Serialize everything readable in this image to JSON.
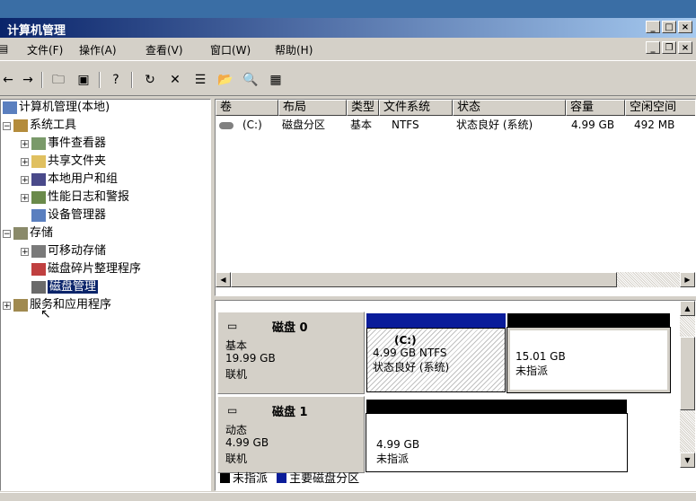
{
  "window": {
    "title": "计算机管理"
  },
  "menu": {
    "items": [
      "文件(F)",
      "操作(A)",
      "查看(V)",
      "窗口(W)",
      "帮助(H)"
    ]
  },
  "tree": {
    "root": "计算机管理(本地)",
    "system_tools": "系统工具",
    "event_viewer": "事件查看器",
    "shared_folders": "共享文件夹",
    "local_users": "本地用户和组",
    "perf_logs": "性能日志和警报",
    "device_manager": "设备管理器",
    "storage": "存储",
    "removable_storage": "可移动存储",
    "defrag": "磁盘碎片整理程序",
    "disk_mgmt": "磁盘管理",
    "services_apps": "服务和应用程序"
  },
  "volume_list": {
    "headers": [
      "卷",
      "布局",
      "类型",
      "文件系统",
      "状态",
      "容量",
      "空闲空间"
    ],
    "rows": [
      {
        "volume": "(C:)",
        "layout": "磁盘分区",
        "type": "基本",
        "fs": "NTFS",
        "status": "状态良好 (系统)",
        "capacity": "4.99 GB",
        "free": "492 MB"
      }
    ]
  },
  "disks": [
    {
      "name": "磁盘 0",
      "type": "基本",
      "size": "19.99 GB",
      "state": "联机",
      "partitions": [
        {
          "label": "(C:)",
          "line1": "4.99 GB NTFS",
          "line2": "状态良好 (系统)",
          "bar_color": "#0a1c9a"
        },
        {
          "label": "",
          "line1": "15.01 GB",
          "line2": "未指派",
          "bar_color": "#000000"
        }
      ]
    },
    {
      "name": "磁盘 1",
      "type": "动态",
      "size": "4.99 GB",
      "state": "联机",
      "partitions": [
        {
          "label": "",
          "line1": "4.99 GB",
          "line2": "未指派",
          "bar_color": "#000000"
        }
      ]
    }
  ],
  "legend": {
    "unallocated": "未指派",
    "primary": "主要磁盘分区",
    "unallocated_color": "#000000",
    "primary_color": "#0a1c9a"
  }
}
